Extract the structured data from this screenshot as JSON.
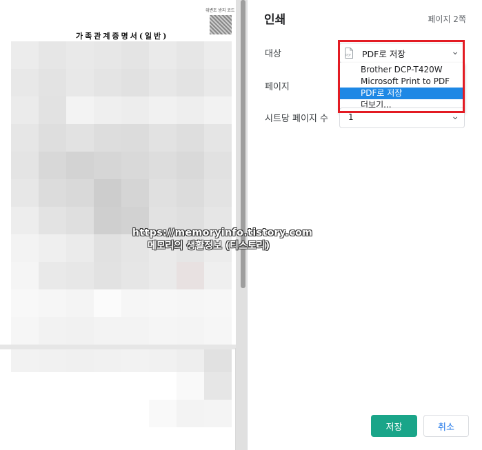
{
  "preview": {
    "document_title": "가족관계증명서(일반)",
    "qr_caption": "위변조 방지 코드"
  },
  "panel": {
    "title": "인쇄",
    "page_count": "페이지 2쪽",
    "destination": {
      "label": "대상",
      "value": "PDF로 저장",
      "icon": "pdf-icon",
      "options": [
        "Brother DCP-T420W",
        "Microsoft Print to PDF",
        "PDF로 저장",
        "더보기..."
      ],
      "selected_index": 2
    },
    "pages_label": "페이지",
    "pages_per_sheet": {
      "label": "시트당 페이지 수",
      "value": "1"
    },
    "save_label": "저장",
    "cancel_label": "취소"
  },
  "watermark": {
    "line1": "https://memoryinfo.tistory.com",
    "line2": "메모리의 생활정보 (티스토리)"
  },
  "colors": {
    "save_button": "#1aa589",
    "selected_option": "#1e88e5",
    "highlight_box": "#e31b23"
  }
}
